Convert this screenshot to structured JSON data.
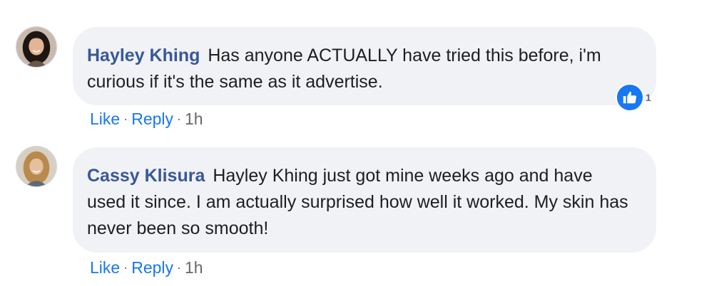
{
  "comments": [
    {
      "author": "Hayley Khing",
      "text": "Has anyone ACTUALLY have tried this before, i'm curious if it's the same as it advertise.",
      "reaction_count": "1",
      "reaction_type": "like-icon",
      "actions": {
        "like": "Like",
        "reply": "Reply",
        "time": "1h",
        "separator": "·"
      }
    },
    {
      "author": "Cassy Klisura",
      "text": "Hayley Khing just got mine weeks ago and have used it since. I am actually surprised how well it worked. My skin has never been so smooth!",
      "actions": {
        "like": "Like",
        "reply": "Reply",
        "time": "1h",
        "separator": "·"
      }
    }
  ],
  "colors": {
    "author": "#385898",
    "link": "#1877f2",
    "bubble": "#f0f2f5",
    "muted": "#65676b",
    "like_badge": "#1877f2"
  }
}
